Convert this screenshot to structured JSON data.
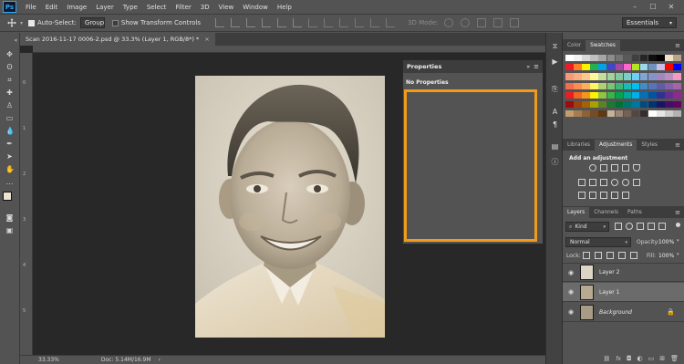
{
  "app": {
    "logo": "Ps"
  },
  "menubar": {
    "items": [
      "File",
      "Edit",
      "Image",
      "Layer",
      "Type",
      "Select",
      "Filter",
      "3D",
      "View",
      "Window",
      "Help"
    ],
    "window_controls": [
      "–",
      "☐",
      "✕"
    ]
  },
  "options": {
    "auto_select_label": "Auto-Select:",
    "auto_select_value": "Group",
    "transform_label": "Show Transform Controls",
    "mode_3d": "3D Mode:",
    "workspace": "Essentials"
  },
  "document": {
    "tab_title": "Scan 2016-11-17 0006-2.psd @ 33.3% (Layer 1, RGB/8*) *",
    "close_glyph": "×"
  },
  "ruler": {
    "left_marks": [
      "0",
      "1",
      "2",
      "3",
      "4",
      "5"
    ]
  },
  "status": {
    "zoom": "33.33%",
    "doc": "Doc: 5.14M/16.9M"
  },
  "properties": {
    "title": "Properties",
    "empty_text": "No Properties"
  },
  "panels": {
    "color_tab": "Color",
    "swatches_tab": "Swatches",
    "libraries_tab": "Libraries",
    "adjustments_tab": "Adjustments",
    "styles_tab": "Styles",
    "add_adjustment": "Add an adjustment",
    "layers_tab": "Layers",
    "channels_tab": "Channels",
    "paths_tab": "Paths",
    "kind_label": "Kind",
    "blend_mode": "Normal",
    "opacity_label": "Opacity:",
    "opacity_value": "100%",
    "lock_label": "Lock:",
    "fill_label": "Fill:",
    "fill_value": "100%"
  },
  "layers": [
    {
      "name": "Layer 2",
      "selected": false,
      "locked": false
    },
    {
      "name": "Layer 1",
      "selected": true,
      "locked": false
    },
    {
      "name": "Background",
      "selected": false,
      "locked": true
    }
  ],
  "colors": {
    "accent_highlight": "#f29a1a",
    "ps_blue": "#31a8ff",
    "swatches": [
      "#ffffff",
      "#f2f2f2",
      "#d9d9d9",
      "#bfbfbf",
      "#a6a6a6",
      "#8c8c8c",
      "#737373",
      "#595959",
      "#404040",
      "#262626",
      "#0d0d0d",
      "#000000",
      "#f2e0c8",
      "#b9a389",
      "#ed1c24",
      "#ff7f27",
      "#fff200",
      "#22b14c",
      "#00a2e8",
      "#3f48cc",
      "#a349a4",
      "#ff66cc",
      "#b5e61d",
      "#99d9ea",
      "#7092be",
      "#c8bfe7",
      "#ff0000",
      "#0000ff",
      "#f7977a",
      "#f9ad81",
      "#fdc68a",
      "#fff79a",
      "#c4df9b",
      "#a3d39c",
      "#82ca9d",
      "#7bcdc8",
      "#6ecff6",
      "#7ea7d8",
      "#8493ca",
      "#a187be",
      "#bc8dbf",
      "#f49ac2",
      "#f26c4f",
      "#f68e55",
      "#fbaf5c",
      "#fff467",
      "#acd372",
      "#7cc576",
      "#3bb878",
      "#1abbb4",
      "#00bff3",
      "#438ccb",
      "#5574b9",
      "#605ca8",
      "#855fa8",
      "#a763a8",
      "#ed1c24",
      "#f26522",
      "#f7941d",
      "#fff200",
      "#8dc63f",
      "#39b54a",
      "#00a651",
      "#00a99d",
      "#00aeef",
      "#0072bc",
      "#0054a6",
      "#2e3192",
      "#662d91",
      "#92278f",
      "#9e0b0f",
      "#a0410d",
      "#a3620a",
      "#aba000",
      "#598527",
      "#1a7b30",
      "#007236",
      "#00746b",
      "#0076a3",
      "#004b80",
      "#003471",
      "#1b1464",
      "#440e62",
      "#630460",
      "#c69c6d",
      "#a67c52",
      "#8c6239",
      "#754c24",
      "#603913",
      "#c7b299",
      "#998675",
      "#736357",
      "#534741",
      "#362f2d",
      "#ffffff",
      "#e6e6e6",
      "#cccccc",
      "#b3b3b3"
    ]
  }
}
